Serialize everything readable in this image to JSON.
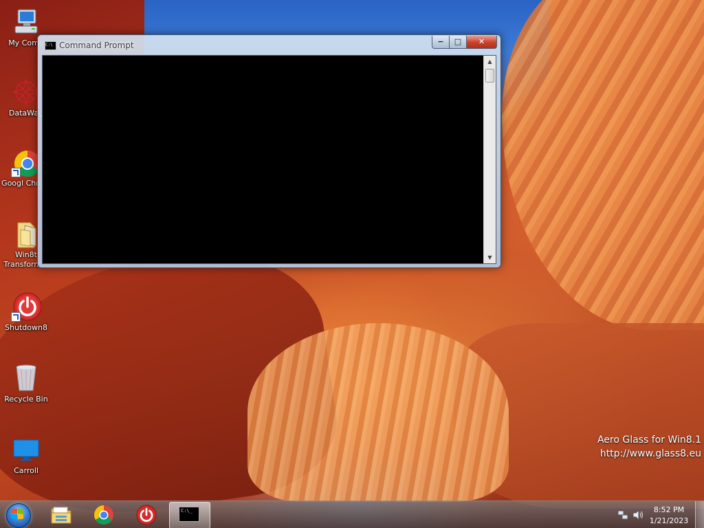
{
  "desktop_icons": [
    {
      "label": "My Comp",
      "icon": "computer-icon"
    },
    {
      "label": "DataWag",
      "icon": "datawag-icon"
    },
    {
      "label": "Googl Chrom",
      "icon": "chrome-icon"
    },
    {
      "label": "Win8t Transform...",
      "icon": "folder-icon"
    },
    {
      "label": "Shutdown8",
      "icon": "power-icon"
    },
    {
      "label": "Recycle Bin",
      "icon": "recycle-bin-icon"
    },
    {
      "label": "Carroll",
      "icon": "monitor-icon"
    }
  ],
  "cmd_window": {
    "title": "Command Prompt",
    "title_icon_text": "C:\\",
    "minimize_symbol": "−",
    "maximize_symbol": "□",
    "close_symbol": "✕",
    "scroll_up_symbol": "▲",
    "scroll_down_symbol": "▼"
  },
  "watermark": {
    "line1": "Aero Glass for Win8.1",
    "line2": "http://www.glass8.eu"
  },
  "taskbar": {
    "pinned": [
      {
        "name": "file-explorer",
        "icon": "folder-icon"
      },
      {
        "name": "chrome",
        "icon": "chrome-icon"
      },
      {
        "name": "shutdown8",
        "icon": "power-icon"
      },
      {
        "name": "command-prompt",
        "icon": "cmd-icon",
        "active": true
      }
    ],
    "cmd_icon_text": "C:\\_",
    "clock": {
      "time": "8:52 PM",
      "date": "1/21/2023"
    }
  },
  "colors": {
    "close_red": "#c8412b",
    "taskbar": "#5a5050",
    "chrome_red": "#db4437",
    "chrome_yellow": "#f4c20d",
    "chrome_green": "#0f9d58",
    "chrome_blue": "#4285f4",
    "power_red": "#d42a2a"
  }
}
